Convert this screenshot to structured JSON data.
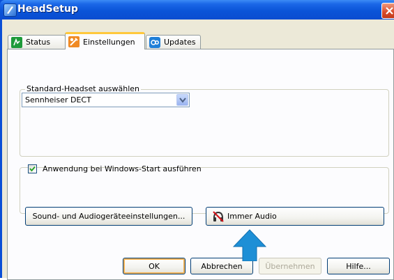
{
  "window": {
    "title": "HeadSetup"
  },
  "tabs": [
    {
      "label": "Status",
      "icon": "status-icon",
      "active": false
    },
    {
      "label": "Einstellungen",
      "icon": "settings-tools-icon",
      "active": true
    },
    {
      "label": "Updates",
      "icon": "updates-icon",
      "active": false
    }
  ],
  "settings": {
    "headset_group_label": "Standard-Headset auswählen",
    "headset_selected": "Sennheiser DECT",
    "autostart_label": "Anwendung bei Windows-Start ausführen",
    "autostart_checked": true,
    "sound_settings_button": "Sound- und Audiogeräteeinstellungen...",
    "always_audio_button": "Immer Audio"
  },
  "footer": {
    "ok": "OK",
    "cancel": "Abbrechen",
    "apply": "Übernehmen",
    "help": "Hilfe..."
  },
  "colors": {
    "titlebar": "#0a54d8",
    "pointer_arrow": "#1e8fd6",
    "dialog_bg": "#ece9d8"
  }
}
